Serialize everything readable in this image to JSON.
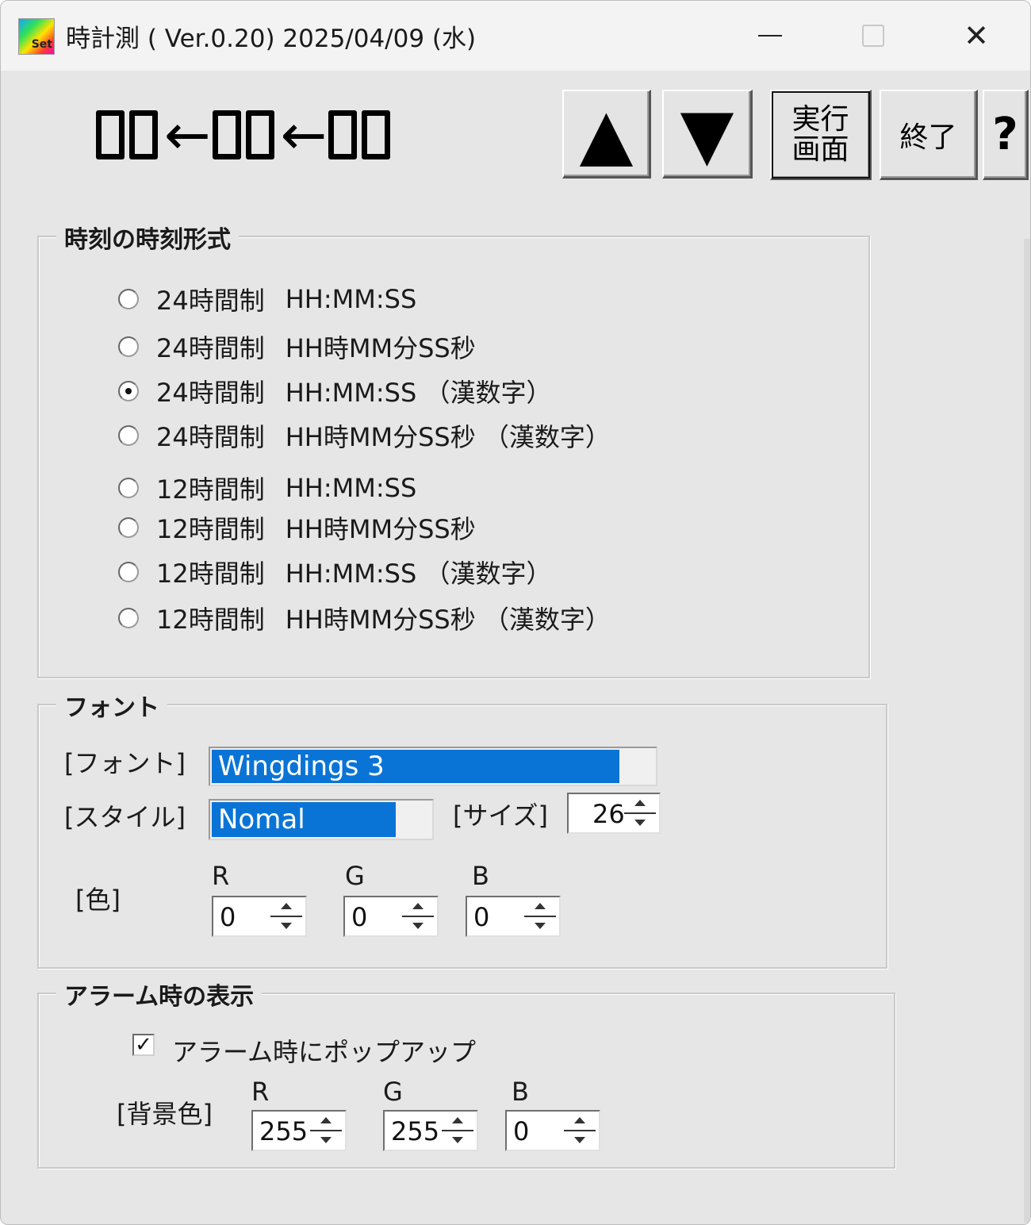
{
  "window": {
    "title": "時計測 ( Ver.0.20)  2025/04/09 (水)",
    "app_icon_text": "Set",
    "close_glyph": "✕"
  },
  "toolbar": {
    "clock_arrow": "←",
    "up_glyph": "▲",
    "down_glyph": "▼",
    "exec_label_line1": "実行",
    "exec_label_line2": "画面",
    "quit_label": "終了",
    "help_label": "?"
  },
  "format_group": {
    "legend": "時刻の時刻形式",
    "options": [
      {
        "mode": "24時間制",
        "fmt": "HH:MM:SS",
        "checked": false
      },
      {
        "mode": "24時間制",
        "fmt": "HH時MM分SS秒",
        "checked": false
      },
      {
        "mode": "24時間制",
        "fmt": "HH:MM:SS （漢数字）",
        "checked": true
      },
      {
        "mode": "24時間制",
        "fmt": "HH時MM分SS秒 （漢数字）",
        "checked": false
      },
      {
        "mode": "12時間制",
        "fmt": "HH:MM:SS",
        "checked": false
      },
      {
        "mode": "12時間制",
        "fmt": "HH時MM分SS秒",
        "checked": false
      },
      {
        "mode": "12時間制",
        "fmt": "HH:MM:SS （漢数字）",
        "checked": false
      },
      {
        "mode": "12時間制",
        "fmt": "HH時MM分SS秒 （漢数字）",
        "checked": false
      }
    ]
  },
  "font_group": {
    "legend": "フォント",
    "font_label": "[フォント]",
    "font_value": "Wingdings 3",
    "style_label": "[スタイル]",
    "style_value": "Nomal",
    "size_label": "[サイズ]",
    "size_value": "26",
    "color_label": "[色]",
    "r_label": "R",
    "g_label": "G",
    "b_label": "B",
    "r_value": "0",
    "g_value": "0",
    "b_value": "0"
  },
  "alarm_group": {
    "legend": "アラーム時の表示",
    "popup_label": "アラーム時にポップアップ",
    "popup_checked": true,
    "check_glyph": "✓",
    "bg_label": "[背景色]",
    "r_label": "R",
    "g_label": "G",
    "b_label": "B",
    "r_value": "255",
    "g_value": "255",
    "b_value": "0"
  }
}
